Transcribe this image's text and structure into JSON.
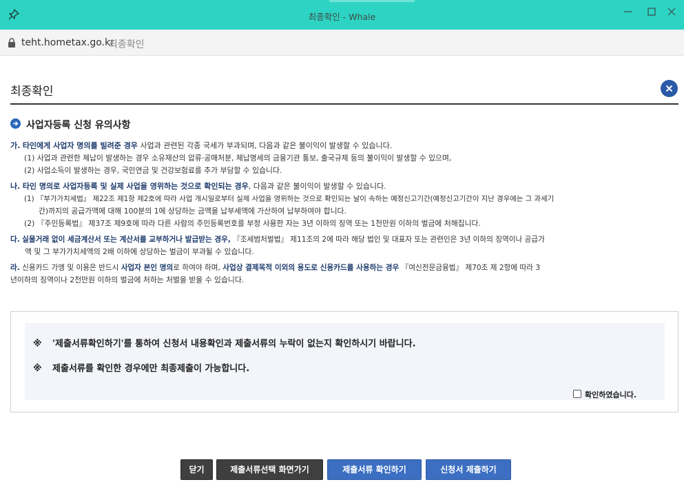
{
  "window": {
    "title": "최종확인 - Whale",
    "address": "teht.hometax.go.kr",
    "page_title": "최종확인"
  },
  "header": {
    "title": "최종확인"
  },
  "section": {
    "title": "사업자등록 신청 유의사항"
  },
  "notices": {
    "ga": {
      "marker": "가.",
      "lead": "타인에게 사업자 명의를 빌려준 경우",
      "text": " 사업과 관련된 각종 국세가 부과되며, 다음과 같은 불이익이 발생할 수 있습니다.",
      "sub1": "(1) 사업과 관련한 체납이 발생하는 경우 소유재산의 압류·공매처분, 체납명세의 금융기관 통보, 출국규제 등의 불이익이 발생할 수 있으며,",
      "sub2": "(2) 사업소득이 발생하는 경우, 국민연금 및 건강보험료를 추가 부담할 수 있습니다."
    },
    "na": {
      "marker": "나.",
      "lead": "타인 명의로 사업자등록 및 실제 사업을 영위하는 것으로 확인되는 경우",
      "text": ", 다음과 같은 불이익이 발생할 수 있습니다.",
      "sub1a": "(1) 『부가가치세법』 제22조 제1항 제2호에 따라 사업 개시일로부터 실제 사업을 영위하는 것으로 확인되는 날이 속하는 예정신고기간(예정신고기간이 지난 경우에는 그 과세기",
      "sub1b": "간)까지의 공급가액에 대해 100분의 1에 상당하는 금액을 납부세액에 가산하여 납부하여야 합니다.",
      "sub2": "(2) 『주민등록법』 제37조 제9호에 따라 다른 사람의 주민등록번호를 부정 사용한 자는 3년 이하의 징역 또는 1천만원 이하의 벌금에 처해집니다."
    },
    "da": {
      "marker": "다.",
      "lead": "실물거래 없이 세금계산서 또는 계산서를 교부하거나 발급받는 경우,",
      "text": " 『조세범처벌법』 제11조의 2에 따라 해당 법인 및 대표자 또는 관련인은 3년 이하의 징역이나 공급가",
      "line2": "액 및 그 부가가치세액의 2배 이하에 상당하는 벌금이 부과될 수 있습니다."
    },
    "ra": {
      "marker": "라.",
      "text1": " 신용카드 가맹 및 이용은 반드시 ",
      "bold1": "사업자 본인 명의",
      "text2": "로 하여야 하며, ",
      "bold2": "사업상 결제목적 이외의 용도로 신용카드를 사용하는 경우",
      "text3": " 『여신전문금융법』 제70조 제 2항에 따라 3",
      "line2": "년이하의 징역이나 2천만원 이하의 벌금에 처하는 처벌을 받을 수 있습니다."
    }
  },
  "confirm": {
    "mark": "※",
    "line1": "'제출서류확인하기'를 통하여 신청서 내용확인과 제출서류의 누락이 없는지 확인하시기 바랍니다.",
    "line2": "제출서류를 확인한 경우에만 최종제출이 가능합니다.",
    "checkbox_label": "확인하였습니다.",
    "checked": false
  },
  "buttons": {
    "close": "닫기",
    "goto_select": "제출서류선택 화면가기",
    "check_docs": "제출서류 확인하기",
    "submit": "신청서 제출하기"
  },
  "colors": {
    "titlebar": "#2ed4c3",
    "accent_blue": "#3c6fc2",
    "dark_button": "#3f3f3f"
  }
}
